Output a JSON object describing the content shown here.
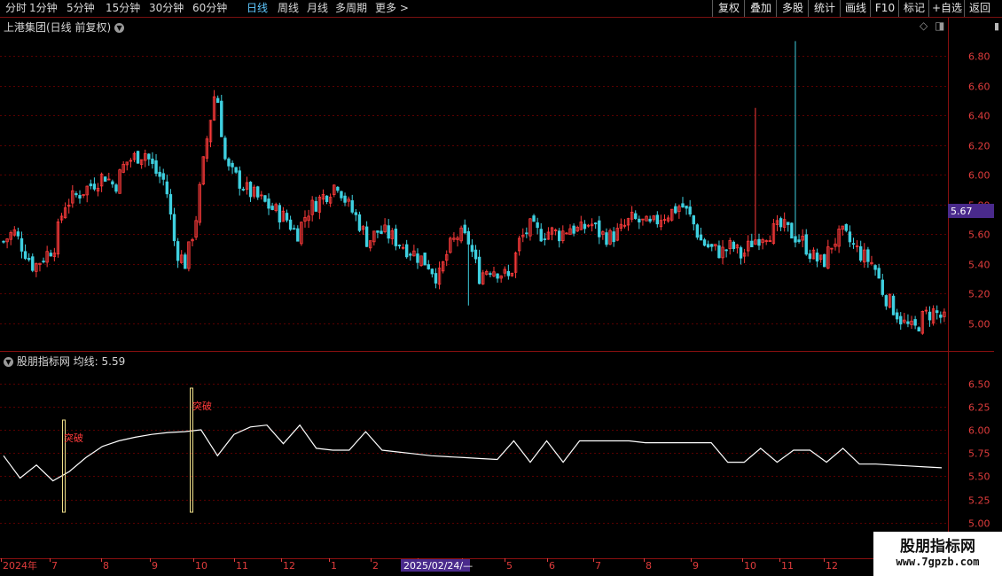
{
  "toolbar": {
    "periods": [
      "分时",
      "1分钟",
      "5分钟",
      "15分钟",
      "30分钟",
      "60分钟",
      "日线",
      "周线",
      "月线",
      "多周期",
      "更多"
    ],
    "active_period": "日线",
    "more_arrow": ">",
    "right_buttons": [
      "复权",
      "叠加",
      "多股",
      "统计",
      "画线",
      "F10",
      "标记",
      "+自选",
      "返回"
    ]
  },
  "main_panel": {
    "title": "上港集团(日线 前复权)",
    "price_label": "5.67",
    "y_ticks": [
      "6.80",
      "6.60",
      "6.40",
      "6.20",
      "6.00",
      "5.80",
      "5.60",
      "5.40",
      "5.20",
      "5.00"
    ]
  },
  "indicator_panel": {
    "title": "股朋指标网",
    "ma_label": "均线: 5.59",
    "signal_label": "突破",
    "y_ticks": [
      "6.50",
      "6.25",
      "6.00",
      "5.75",
      "5.50",
      "5.25",
      "5.00"
    ]
  },
  "x_axis": {
    "labels": [
      "2024年",
      "7",
      "8",
      "9",
      "10",
      "11",
      "12",
      "1",
      "2",
      "3",
      "4",
      "5",
      "6",
      "7",
      "8",
      "9",
      "10",
      "11",
      "12"
    ],
    "cursor_date": "2025/02/24/—"
  },
  "watermark": {
    "title": "股朋指标网",
    "url": "www.7gpzb.com"
  },
  "colors": {
    "up": "#ff3b3b",
    "down": "#3fd0e0",
    "grid": "#5a0000",
    "axis_text": "#e03c3c",
    "price_tag_bg": "#4a2a8c",
    "indicator_line": "#ffffff",
    "signal_bar": "#f0e08a"
  },
  "chart_data": [
    {
      "type": "candlestick",
      "title": "上港集团(日线 前复权)",
      "ylim": [
        4.85,
        6.95
      ],
      "x_labels": [
        "2024年",
        "7",
        "8",
        "9",
        "10",
        "11",
        "12",
        "1",
        "2",
        "3",
        "4",
        "5",
        "6",
        "7",
        "8",
        "9",
        "10",
        "11",
        "12"
      ],
      "closes": [
        5.55,
        5.62,
        5.5,
        5.38,
        5.45,
        5.52,
        5.8,
        5.85,
        5.9,
        5.95,
        6.0,
        5.92,
        6.08,
        6.12,
        6.15,
        6.02,
        5.95,
        5.5,
        5.4,
        5.7,
        6.2,
        6.6,
        6.05,
        5.98,
        5.9,
        5.85,
        5.8,
        5.75,
        5.7,
        5.6,
        5.75,
        5.82,
        5.88,
        5.95,
        5.8,
        5.7,
        5.55,
        5.62,
        5.6,
        5.55,
        5.5,
        5.45,
        5.4,
        5.3,
        5.5,
        5.6,
        5.55,
        5.32,
        5.38,
        5.35,
        5.3,
        5.55,
        5.65,
        5.6,
        5.62,
        5.6,
        5.65,
        5.62,
        5.68,
        5.6,
        5.58,
        5.62,
        5.7,
        5.68,
        5.65,
        5.72,
        5.75,
        5.8,
        5.7,
        5.55,
        5.5,
        5.48,
        5.52,
        5.45,
        5.55,
        5.6,
        5.62,
        5.65,
        5.6,
        5.55,
        5.45,
        5.4,
        5.55,
        5.6,
        5.52,
        5.45,
        5.4,
        5.2,
        5.1,
        5.0,
        4.95,
        5.05,
        5.08,
        5.02
      ],
      "last_price": 5.67
    },
    {
      "type": "line",
      "title": "股朋指标网",
      "series": [
        {
          "name": "均线",
          "values": [
            5.72,
            5.48,
            5.62,
            5.45,
            5.55,
            5.7,
            5.82,
            5.88,
            5.92,
            5.95,
            5.97,
            5.98,
            6.0,
            5.72,
            5.95,
            6.03,
            6.05,
            5.85,
            6.05,
            5.8,
            5.78,
            5.78,
            5.98,
            5.78,
            5.76,
            5.74,
            5.72,
            5.71,
            5.7,
            5.69,
            5.68,
            5.88,
            5.65,
            5.88,
            5.65,
            5.88,
            5.88,
            5.88,
            5.88,
            5.86,
            5.86,
            5.86,
            5.86,
            5.86,
            5.65,
            5.65,
            5.8,
            5.65,
            5.78,
            5.78,
            5.65,
            5.8,
            5.63,
            5.63,
            5.62,
            5.61,
            5.6,
            5.59
          ]
        }
      ],
      "ylim": [
        4.95,
        6.62
      ],
      "last_value": 5.59,
      "signals": [
        "突破",
        "突破"
      ]
    }
  ]
}
